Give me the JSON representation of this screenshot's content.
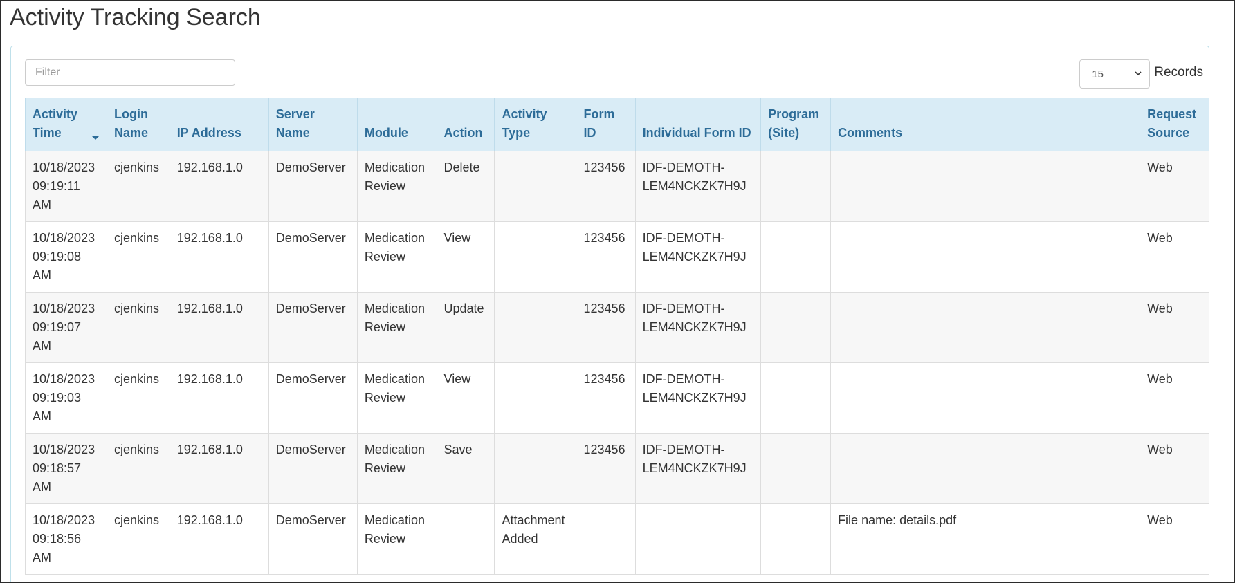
{
  "page": {
    "title": "Activity Tracking Search"
  },
  "filter": {
    "placeholder": "Filter",
    "value": ""
  },
  "pager": {
    "page_size": "15",
    "label": "Records"
  },
  "colors": {
    "header_bg": "#d9ecf6",
    "header_text": "#2d6c98",
    "stripe": "#f7f7f7"
  },
  "table": {
    "sorted_column": "Activity Time",
    "sort_direction": "descending",
    "columns": [
      "Activity Time",
      "Login Name",
      "IP Address",
      "Server Name",
      "Module",
      "Action",
      "Activity Type",
      "Form ID",
      "Individual Form ID",
      "Program (Site)",
      "Comments",
      "Request Source"
    ],
    "rows": [
      [
        "10/18/2023 09:19:11 AM",
        "cjenkins",
        "192.168.1.0",
        "DemoServer",
        "Medication Review",
        "Delete",
        "",
        "123456",
        "IDF-DEMOTH-LEM4NCKZK7H9J",
        "",
        "",
        "Web"
      ],
      [
        "10/18/2023 09:19:08 AM",
        "cjenkins",
        "192.168.1.0",
        "DemoServer",
        "Medication Review",
        "View",
        "",
        "123456",
        "IDF-DEMOTH-LEM4NCKZK7H9J",
        "",
        "",
        "Web"
      ],
      [
        "10/18/2023 09:19:07 AM",
        "cjenkins",
        "192.168.1.0",
        "DemoServer",
        "Medication Review",
        "Update",
        "",
        "123456",
        "IDF-DEMOTH-LEM4NCKZK7H9J",
        "",
        "",
        "Web"
      ],
      [
        "10/18/2023 09:19:03 AM",
        "cjenkins",
        "192.168.1.0",
        "DemoServer",
        "Medication Review",
        "View",
        "",
        "123456",
        "IDF-DEMOTH-LEM4NCKZK7H9J",
        "",
        "",
        "Web"
      ],
      [
        "10/18/2023 09:18:57 AM",
        "cjenkins",
        "192.168.1.0",
        "DemoServer",
        "Medication Review",
        "Save",
        "",
        "123456",
        "IDF-DEMOTH-LEM4NCKZK7H9J",
        "",
        "",
        "Web"
      ],
      [
        "10/18/2023 09:18:56 AM",
        "cjenkins",
        "192.168.1.0",
        "DemoServer",
        "Medication Review",
        "",
        "Attachment Added",
        "",
        "",
        "",
        "File name: details.pdf",
        "Web"
      ]
    ]
  }
}
